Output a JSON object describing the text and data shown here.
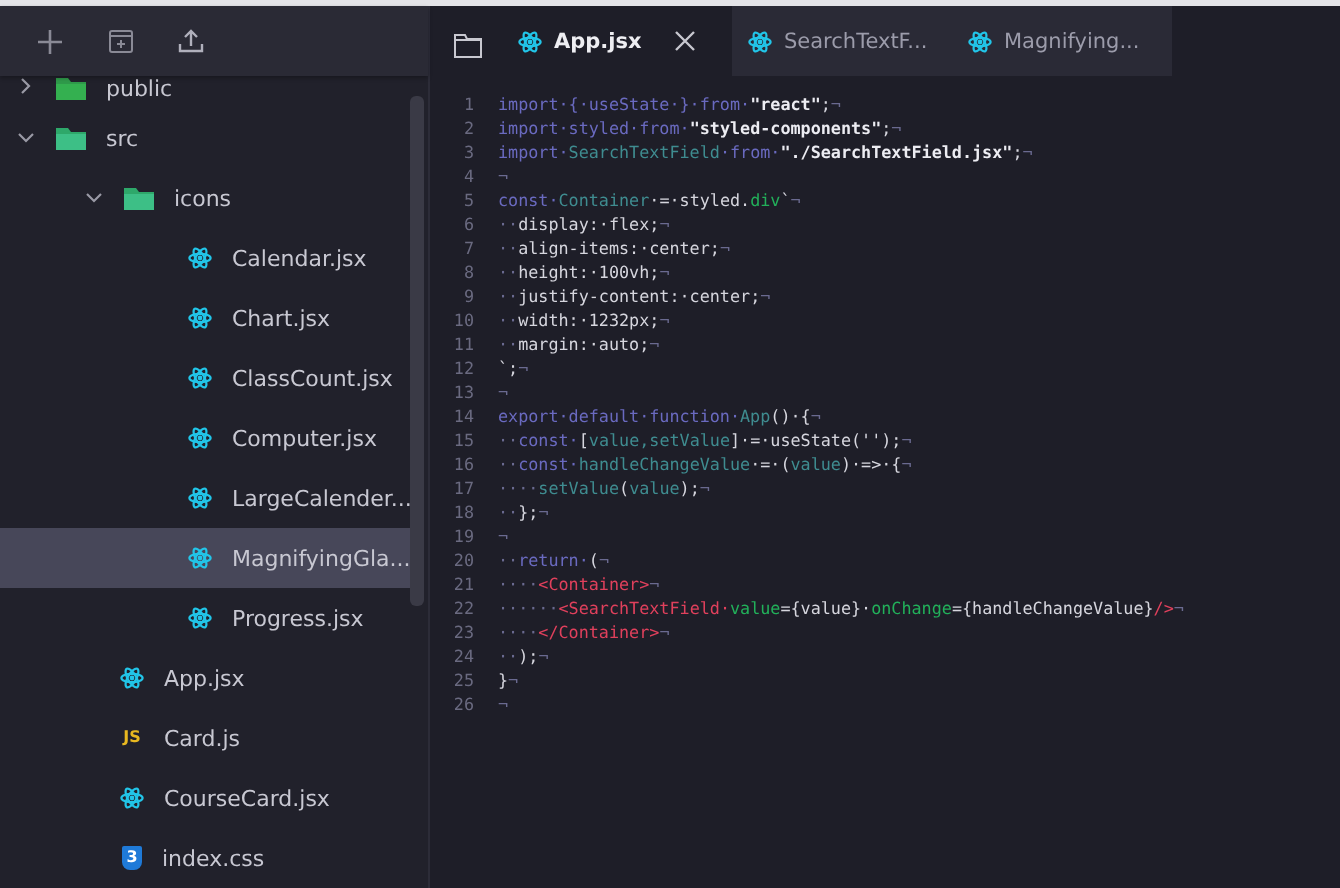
{
  "explorer": {
    "tree": [
      {
        "label": "public",
        "kind": "folder",
        "expanded": false,
        "selected": false
      },
      {
        "label": "src",
        "kind": "folder",
        "expanded": true,
        "selected": false,
        "children": [
          {
            "label": "icons",
            "kind": "folder",
            "expanded": true,
            "selected": false,
            "children": [
              {
                "label": "Calendar.jsx",
                "kind": "react",
                "selected": false
              },
              {
                "label": "Chart.jsx",
                "kind": "react",
                "selected": false
              },
              {
                "label": "ClassCount.jsx",
                "kind": "react",
                "selected": false
              },
              {
                "label": "Computer.jsx",
                "kind": "react",
                "selected": false
              },
              {
                "label": "LargeCalender...",
                "kind": "react",
                "selected": false
              },
              {
                "label": "MagnifyingGla...",
                "kind": "react",
                "selected": true
              },
              {
                "label": "Progress.jsx",
                "kind": "react",
                "selected": false
              }
            ]
          },
          {
            "label": "App.jsx",
            "kind": "react",
            "selected": false
          },
          {
            "label": "Card.js",
            "kind": "js",
            "badge": "JS",
            "selected": false
          },
          {
            "label": "CourseCard.jsx",
            "kind": "react",
            "selected": false
          },
          {
            "label": "index.css",
            "kind": "css",
            "badge": "3",
            "selected": false
          }
        ]
      }
    ]
  },
  "tabs": [
    {
      "label": "App.jsx",
      "selected": true
    },
    {
      "label": "SearchTextF...",
      "selected": false
    },
    {
      "label": "Magnifying...",
      "selected": false
    }
  ],
  "editor": {
    "lines": [
      {
        "number": "1",
        "segments": [
          {
            "kind": "kw",
            "text": "import·{·useState·}·from·"
          },
          {
            "kind": "str",
            "text": "\"react\""
          },
          {
            "kind": "pl",
            "text": ";"
          },
          {
            "kind": "ws",
            "text": "¬"
          }
        ]
      },
      {
        "number": "2",
        "segments": [
          {
            "kind": "kw",
            "text": "import·styled·from·"
          },
          {
            "kind": "str",
            "text": "\"styled-components\""
          },
          {
            "kind": "pl",
            "text": ";"
          },
          {
            "kind": "ws",
            "text": "¬"
          }
        ]
      },
      {
        "number": "3",
        "segments": [
          {
            "kind": "kw",
            "text": "import·"
          },
          {
            "kind": "id",
            "text": "SearchTextField"
          },
          {
            "kind": "kw",
            "text": "·from·"
          },
          {
            "kind": "str",
            "text": "\"./SearchTextField.jsx\""
          },
          {
            "kind": "pl",
            "text": ";"
          },
          {
            "kind": "ws",
            "text": "¬"
          }
        ]
      },
      {
        "number": "4",
        "segments": [
          {
            "kind": "ws",
            "text": "¬"
          }
        ]
      },
      {
        "number": "5",
        "segments": [
          {
            "kind": "kw",
            "text": "const·"
          },
          {
            "kind": "id",
            "text": "Container"
          },
          {
            "kind": "pl",
            "text": "·=·styled."
          },
          {
            "kind": "at",
            "text": "div"
          },
          {
            "kind": "pl",
            "text": "`"
          },
          {
            "kind": "ws",
            "text": "¬"
          }
        ]
      },
      {
        "number": "6",
        "segments": [
          {
            "kind": "ws",
            "text": "··"
          },
          {
            "kind": "pl",
            "text": "display:·flex;"
          },
          {
            "kind": "ws",
            "text": "¬"
          }
        ]
      },
      {
        "number": "7",
        "segments": [
          {
            "kind": "ws",
            "text": "··"
          },
          {
            "kind": "pl",
            "text": "align-items:·center;"
          },
          {
            "kind": "ws",
            "text": "¬"
          }
        ]
      },
      {
        "number": "8",
        "segments": [
          {
            "kind": "ws",
            "text": "··"
          },
          {
            "kind": "pl",
            "text": "height:·100vh;"
          },
          {
            "kind": "ws",
            "text": "¬"
          }
        ]
      },
      {
        "number": "9",
        "segments": [
          {
            "kind": "ws",
            "text": "··"
          },
          {
            "kind": "pl",
            "text": "justify-content:·center;"
          },
          {
            "kind": "ws",
            "text": "¬"
          }
        ]
      },
      {
        "number": "10",
        "segments": [
          {
            "kind": "ws",
            "text": "··"
          },
          {
            "kind": "pl",
            "text": "width:·1232px;"
          },
          {
            "kind": "ws",
            "text": "¬"
          }
        ]
      },
      {
        "number": "11",
        "segments": [
          {
            "kind": "ws",
            "text": "··"
          },
          {
            "kind": "pl",
            "text": "margin:·auto;"
          },
          {
            "kind": "ws",
            "text": "¬"
          }
        ]
      },
      {
        "number": "12",
        "segments": [
          {
            "kind": "pl",
            "text": "`;"
          },
          {
            "kind": "ws",
            "text": "¬"
          }
        ]
      },
      {
        "number": "13",
        "segments": [
          {
            "kind": "ws",
            "text": "¬"
          }
        ]
      },
      {
        "number": "14",
        "segments": [
          {
            "kind": "kw",
            "text": "export·default·function·"
          },
          {
            "kind": "id",
            "text": "App"
          },
          {
            "kind": "pl",
            "text": "()·{"
          },
          {
            "kind": "ws",
            "text": "¬"
          }
        ]
      },
      {
        "number": "15",
        "segments": [
          {
            "kind": "ws",
            "text": "··"
          },
          {
            "kind": "kw",
            "text": "const·"
          },
          {
            "kind": "pl",
            "text": "["
          },
          {
            "kind": "id",
            "text": "value,setValue"
          },
          {
            "kind": "pl",
            "text": "]·=·useState('');"
          },
          {
            "kind": "ws",
            "text": "¬"
          }
        ]
      },
      {
        "number": "16",
        "segments": [
          {
            "kind": "ws",
            "text": "··"
          },
          {
            "kind": "kw",
            "text": "const·"
          },
          {
            "kind": "id",
            "text": "handleChangeValue"
          },
          {
            "kind": "pl",
            "text": "·=·("
          },
          {
            "kind": "id",
            "text": "value"
          },
          {
            "kind": "pl",
            "text": ")·=>·{"
          },
          {
            "kind": "ws",
            "text": "¬"
          }
        ]
      },
      {
        "number": "17",
        "segments": [
          {
            "kind": "ws",
            "text": "····"
          },
          {
            "kind": "id",
            "text": "setValue"
          },
          {
            "kind": "pl",
            "text": "("
          },
          {
            "kind": "id",
            "text": "value"
          },
          {
            "kind": "pl",
            "text": ");"
          },
          {
            "kind": "ws",
            "text": "¬"
          }
        ]
      },
      {
        "number": "18",
        "segments": [
          {
            "kind": "ws",
            "text": "··"
          },
          {
            "kind": "pl",
            "text": "};"
          },
          {
            "kind": "ws",
            "text": "¬"
          }
        ]
      },
      {
        "number": "19",
        "segments": [
          {
            "kind": "ws",
            "text": "¬"
          }
        ]
      },
      {
        "number": "20",
        "segments": [
          {
            "kind": "ws",
            "text": "··"
          },
          {
            "kind": "kw",
            "text": "return·"
          },
          {
            "kind": "pl",
            "text": "("
          },
          {
            "kind": "ws",
            "text": "¬"
          }
        ]
      },
      {
        "number": "21",
        "segments": [
          {
            "kind": "ws",
            "text": "····"
          },
          {
            "kind": "tg",
            "text": "<Container>"
          },
          {
            "kind": "ws",
            "text": "¬"
          }
        ]
      },
      {
        "number": "22",
        "segments": [
          {
            "kind": "ws",
            "text": "······"
          },
          {
            "kind": "tg",
            "text": "<SearchTextField·"
          },
          {
            "kind": "at",
            "text": "value"
          },
          {
            "kind": "pl",
            "text": "={value}·"
          },
          {
            "kind": "at",
            "text": "onChange"
          },
          {
            "kind": "pl",
            "text": "={handleChangeValue}"
          },
          {
            "kind": "tg",
            "text": "/>"
          },
          {
            "kind": "ws",
            "text": "¬"
          }
        ]
      },
      {
        "number": "23",
        "segments": [
          {
            "kind": "ws",
            "text": "····"
          },
          {
            "kind": "tg",
            "text": "</Container>"
          },
          {
            "kind": "ws",
            "text": "¬"
          }
        ]
      },
      {
        "number": "24",
        "segments": [
          {
            "kind": "ws",
            "text": "··"
          },
          {
            "kind": "pl",
            "text": ");"
          },
          {
            "kind": "ws",
            "text": "¬"
          }
        ]
      },
      {
        "number": "25",
        "segments": [
          {
            "kind": "pl",
            "text": "}"
          },
          {
            "kind": "ws",
            "text": "¬"
          }
        ]
      },
      {
        "number": "26",
        "segments": [
          {
            "kind": "ws",
            "text": "¬"
          }
        ]
      }
    ]
  }
}
